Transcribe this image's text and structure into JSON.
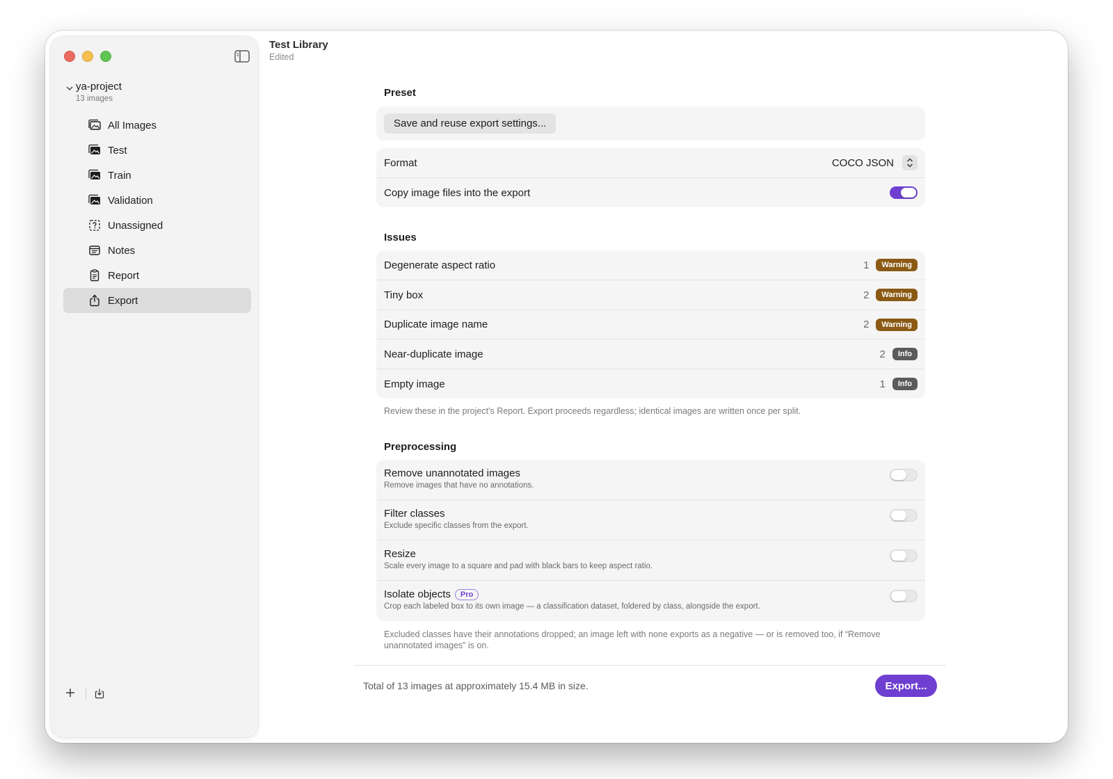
{
  "window": {
    "title": "Test Library",
    "subtitle": "Edited"
  },
  "sidebar": {
    "project": {
      "name": "ya-project",
      "count": "13 images"
    },
    "items": [
      {
        "label": "All Images",
        "icon": "photo-stack-icon"
      },
      {
        "label": "Test",
        "icon": "photo-stack-filled-icon"
      },
      {
        "label": "Train",
        "icon": "photo-stack-filled-icon"
      },
      {
        "label": "Validation",
        "icon": "photo-stack-filled-icon"
      },
      {
        "label": "Unassigned",
        "icon": "dashed-question-icon"
      },
      {
        "label": "Notes",
        "icon": "notes-icon"
      },
      {
        "label": "Report",
        "icon": "clipboard-icon"
      },
      {
        "label": "Export",
        "icon": "share-icon",
        "active": true
      }
    ]
  },
  "preset": {
    "section": "Preset",
    "button": "Save and reuse export settings..."
  },
  "format": {
    "label": "Format",
    "value": "COCO JSON",
    "copy_label": "Copy image files into the export",
    "copy_on": true
  },
  "issues": {
    "section": "Issues",
    "rows": [
      {
        "label": "Degenerate aspect ratio",
        "count": "1",
        "badge": "Warning"
      },
      {
        "label": "Tiny box",
        "count": "2",
        "badge": "Warning"
      },
      {
        "label": "Duplicate image name",
        "count": "2",
        "badge": "Warning"
      },
      {
        "label": "Near-duplicate image",
        "count": "2",
        "badge": "Info"
      },
      {
        "label": "Empty image",
        "count": "1",
        "badge": "Info"
      }
    ],
    "note": "Review these in the project's Report. Export proceeds regardless; identical images are written once per split."
  },
  "preprocessing": {
    "section": "Preprocessing",
    "rows": [
      {
        "label": "Remove unannotated images",
        "sub": "Remove images that have no annotations.",
        "on": false
      },
      {
        "label": "Filter classes",
        "sub": "Exclude specific classes from the export.",
        "on": false
      },
      {
        "label": "Resize",
        "sub": "Scale every image to a square and pad with black bars to keep aspect ratio.",
        "on": false
      },
      {
        "label": "Isolate objects",
        "pro": "Pro",
        "sub": "Crop each labeled box to its own image — a classification dataset, foldered by class, alongside the export.",
        "on": false
      }
    ],
    "note": "Excluded classes have their annotations dropped; an image left with none exports as a negative — or is removed too, if “Remove unannotated images” is on."
  },
  "footer": {
    "summary": "Total of 13 images at approximately 15.4 MB in size.",
    "export_label": "Export..."
  },
  "colors": {
    "accent": "#6e3fd1",
    "warning": "#8a5a14",
    "info": "#5b5b5b"
  }
}
